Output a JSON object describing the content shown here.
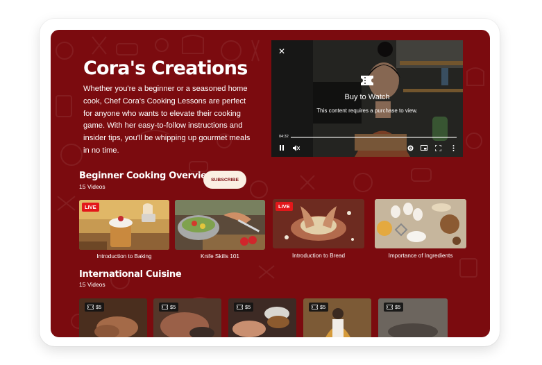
{
  "page": {
    "title": "Cora's Creations",
    "description": "Whether you're a beginner or a seasoned home cook, Chef Cora's Cooking Lessons are perfect for anyone who wants to elevate their cooking game. With her easy-to-follow instructions and insider tips, you'll be whipping up gourmet meals in no time."
  },
  "player": {
    "buy_title": "Buy to Watch",
    "buy_subtitle": "This content requires a purchase to view.",
    "time": "04:32",
    "progress": 0
  },
  "sections": [
    {
      "title": "Beginner Cooking Overview",
      "count": "15 Videos",
      "subscribe_label": "SUBSCRIBE",
      "videos": [
        {
          "title": "Introduction to Baking",
          "badge": "LIVE"
        },
        {
          "title": "Knife Skills 101",
          "badge": ""
        },
        {
          "title": "Introduction to Bread",
          "badge": "LIVE"
        },
        {
          "title": "Importance of Ingredients",
          "badge": ""
        }
      ]
    },
    {
      "title": "International Cuisine",
      "count": "15 Videos",
      "videos": [
        {
          "price": "$5"
        },
        {
          "price": "$5"
        },
        {
          "price": "$5"
        },
        {
          "price": "$5"
        },
        {
          "price": "$5"
        }
      ]
    }
  ],
  "colors": {
    "background": "#7b0b0f",
    "live_badge": "#e3171a",
    "subscribe_bg": "#fbefe3",
    "price_badge": "#141414"
  },
  "icons": [
    "close-icon",
    "ticket-icon",
    "pause-icon",
    "mute-icon",
    "settings-icon",
    "picture-in-picture-icon",
    "fullscreen-icon",
    "more-icon"
  ]
}
